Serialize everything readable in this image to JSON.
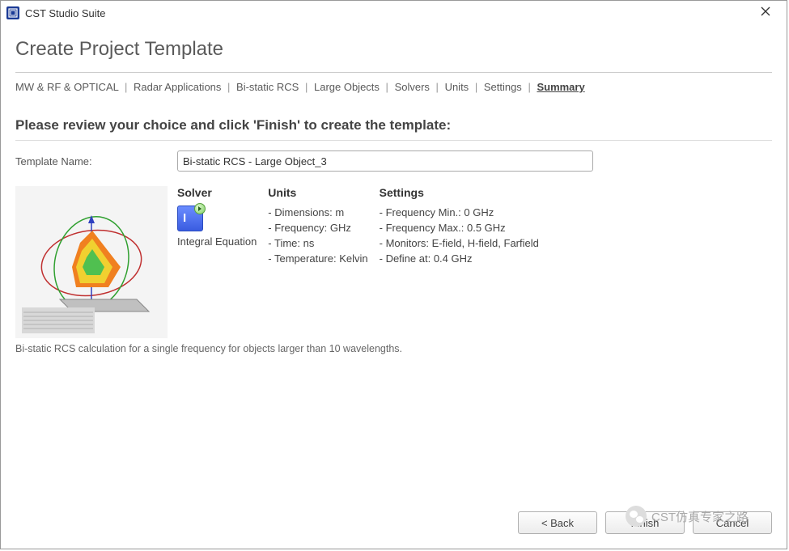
{
  "window": {
    "title": "CST Studio Suite"
  },
  "page": {
    "heading": "Create Project Template"
  },
  "breadcrumb": {
    "items": [
      "MW & RF & OPTICAL",
      "Radar Applications",
      "Bi-static RCS",
      "Large Objects",
      "Solvers",
      "Units",
      "Settings",
      "Summary"
    ],
    "separator": "|",
    "current_index": 7
  },
  "instruction": "Please review your choice and click 'Finish' to create the template:",
  "template_name": {
    "label": "Template Name:",
    "value": "Bi-static RCS - Large Object_3"
  },
  "solver": {
    "heading": "Solver",
    "icon_letter": "I",
    "name": "Integral Equation"
  },
  "units": {
    "heading": "Units",
    "lines": [
      "- Dimensions: m",
      "- Frequency: GHz",
      "- Time: ns",
      "- Temperature: Kelvin"
    ]
  },
  "settings": {
    "heading": "Settings",
    "lines": [
      "- Frequency Min.: 0 GHz",
      "- Frequency Max.: 0.5 GHz",
      "- Monitors: E-field, H-field, Farfield",
      "- Define at: 0.4 GHz"
    ]
  },
  "description": "Bi-static RCS calculation for a single frequency for objects larger than 10 wavelengths.",
  "buttons": {
    "back": "< Back",
    "finish": "Finish",
    "cancel": "Cancel"
  },
  "watermark": "CST仿真专家之路"
}
